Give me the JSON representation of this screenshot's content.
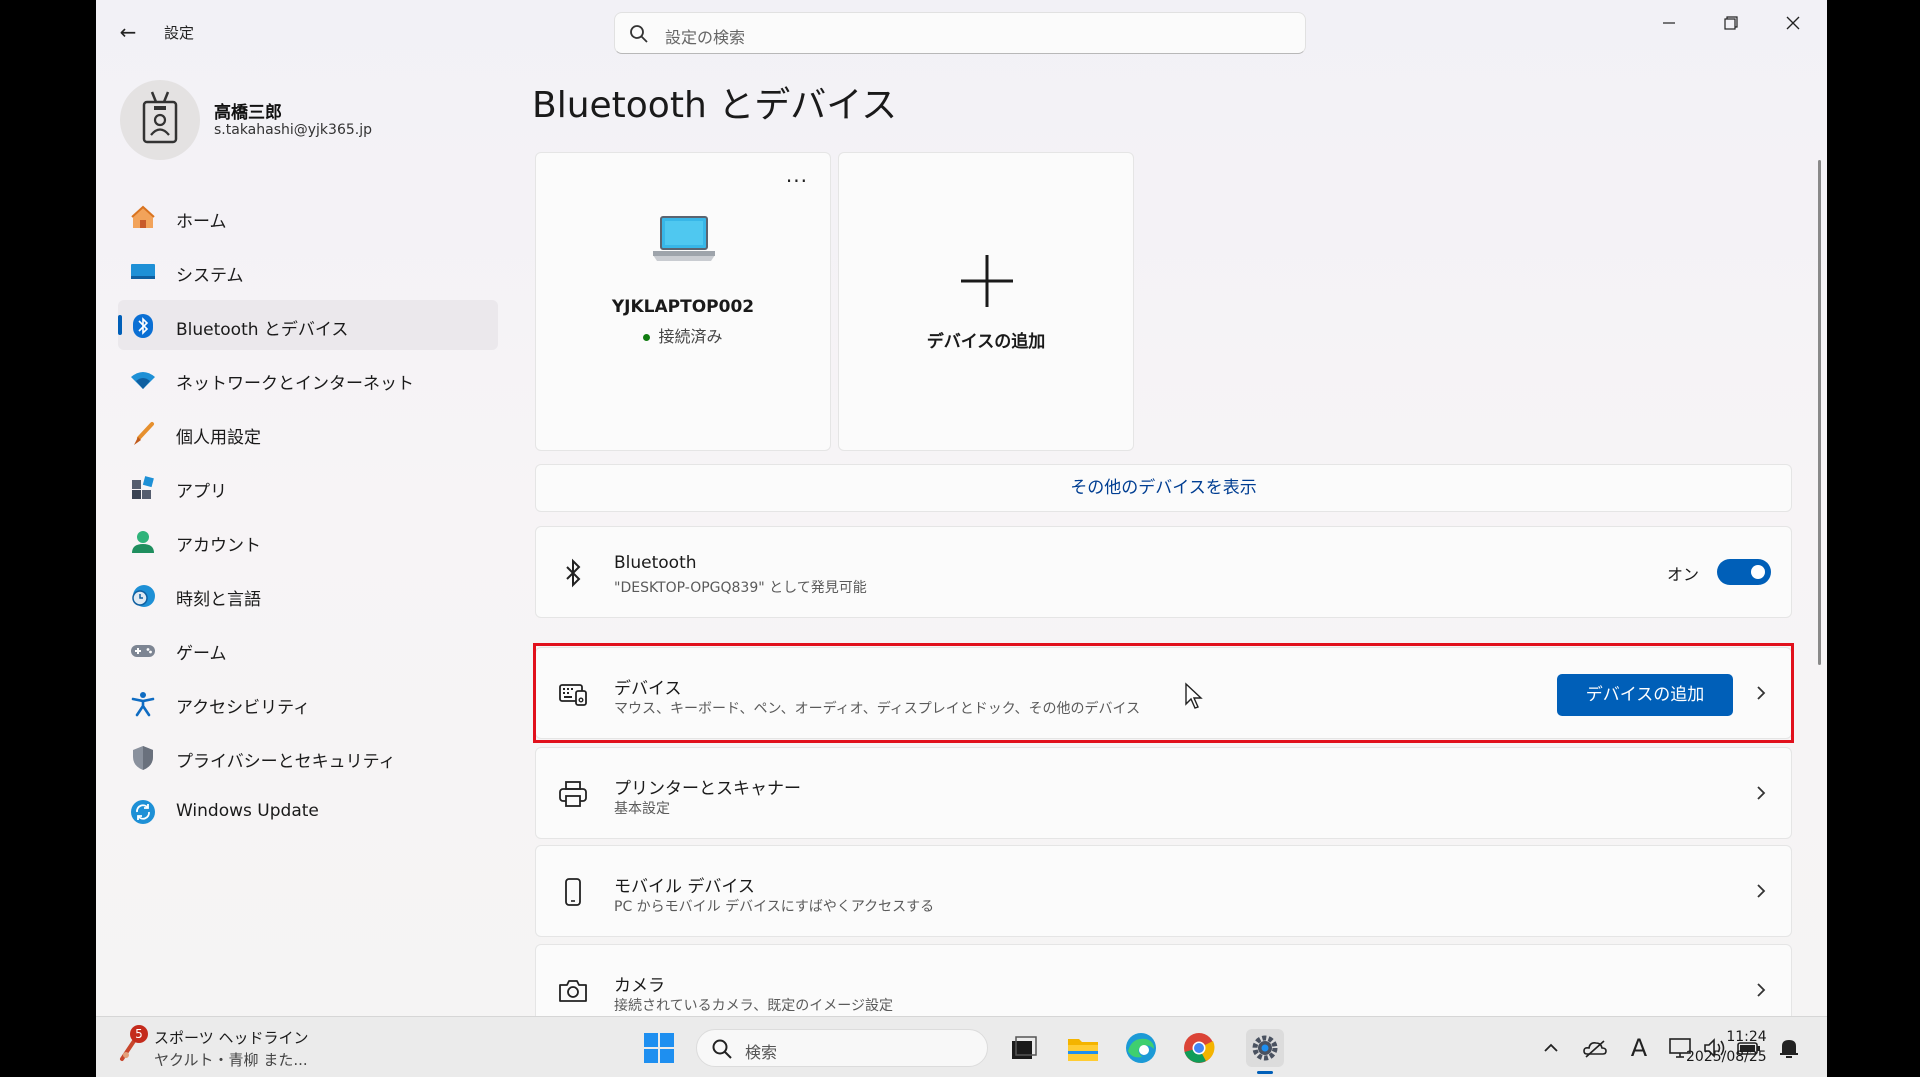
{
  "window": {
    "app_title": "設定",
    "search_placeholder": "設定の検索"
  },
  "profile": {
    "name": "高橋三郎",
    "email": "s.takahashi@yjk365.jp"
  },
  "nav": {
    "items": [
      {
        "label": "ホーム",
        "icon": "home-icon"
      },
      {
        "label": "システム",
        "icon": "system-icon"
      },
      {
        "label": "Bluetooth とデバイス",
        "icon": "bluetooth-icon",
        "active": true
      },
      {
        "label": "ネットワークとインターネット",
        "icon": "wifi-icon"
      },
      {
        "label": "個人用設定",
        "icon": "brush-icon"
      },
      {
        "label": "アプリ",
        "icon": "apps-icon"
      },
      {
        "label": "アカウント",
        "icon": "account-icon"
      },
      {
        "label": "時刻と言語",
        "icon": "time-language-icon"
      },
      {
        "label": "ゲーム",
        "icon": "gamepad-icon"
      },
      {
        "label": "アクセシビリティ",
        "icon": "accessibility-icon"
      },
      {
        "label": "プライバシーとセキュリティ",
        "icon": "shield-icon"
      },
      {
        "label": "Windows Update",
        "icon": "update-icon"
      }
    ]
  },
  "main": {
    "page_title": "Bluetooth とデバイス",
    "device_card": {
      "name": "YJKLAPTOP002",
      "status": "接続済み",
      "more": "..."
    },
    "add_card": {
      "label": "デバイスの追加"
    },
    "show_more": "その他のデバイスを表示",
    "bluetooth_row": {
      "title": "Bluetooth",
      "subtitle": "\"DESKTOP-OPGQ839\" として発見可能",
      "toggle_label": "オン",
      "toggle_on": true
    },
    "devices_row": {
      "title": "デバイス",
      "subtitle": "マウス、キーボード、ペン、オーディオ、ディスプレイとドック、その他のデバイス",
      "button": "デバイスの追加"
    },
    "printers_row": {
      "title": "プリンターとスキャナー",
      "subtitle": "基本設定"
    },
    "mobile_row": {
      "title": "モバイル デバイス",
      "subtitle": "PC からモバイル デバイスにすばやくアクセスする"
    },
    "camera_row": {
      "title": "カメラ",
      "subtitle": "接続されているカメラ、既定のイメージ設定"
    }
  },
  "taskbar": {
    "news_badge": "5",
    "news_line1": "スポーツ ヘッドライン",
    "news_line2": "ヤクルト・青柳 また...",
    "search_placeholder": "検索",
    "time": "11:24",
    "date": "2025/08/25",
    "ime": "A"
  },
  "colors": {
    "accent": "#005fb8",
    "highlight_border": "#e1101c",
    "connected_dot": "#107c10"
  }
}
